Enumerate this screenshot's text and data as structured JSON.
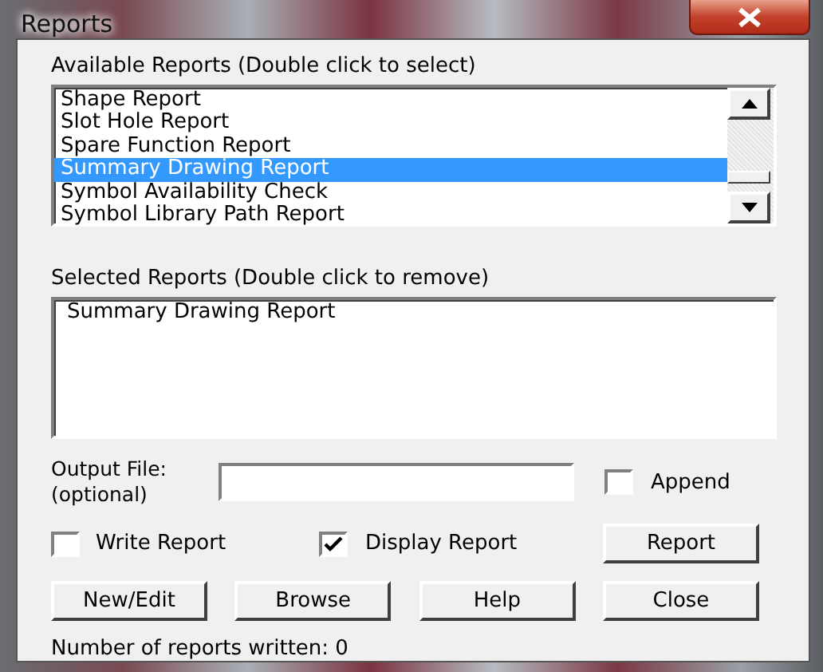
{
  "window": {
    "title": "Reports"
  },
  "available": {
    "label": "Available Reports (Double click to select)",
    "items": [
      {
        "text": "Shape Report",
        "selected": false
      },
      {
        "text": "Slot Hole Report",
        "selected": false
      },
      {
        "text": "Spare Function Report",
        "selected": false
      },
      {
        "text": "Summary Drawing Report",
        "selected": true
      },
      {
        "text": "Symbol Availability Check",
        "selected": false
      },
      {
        "text": "Symbol Library Path Report",
        "selected": false
      }
    ]
  },
  "selected_reports": {
    "label": "Selected Reports (Double click to remove)",
    "items": [
      "Summary Drawing Report"
    ]
  },
  "output_file": {
    "label_line1": "Output File:",
    "label_line2": "(optional)"
  },
  "append": {
    "label": "Append",
    "checked": false
  },
  "write_report": {
    "label": "Write Report",
    "checked": false
  },
  "display_report": {
    "label": "Display Report",
    "checked": true
  },
  "report_button": "Report",
  "buttons": [
    "New/Edit",
    "Browse",
    "Help",
    "Close"
  ],
  "status": "Number of reports written: 0"
}
